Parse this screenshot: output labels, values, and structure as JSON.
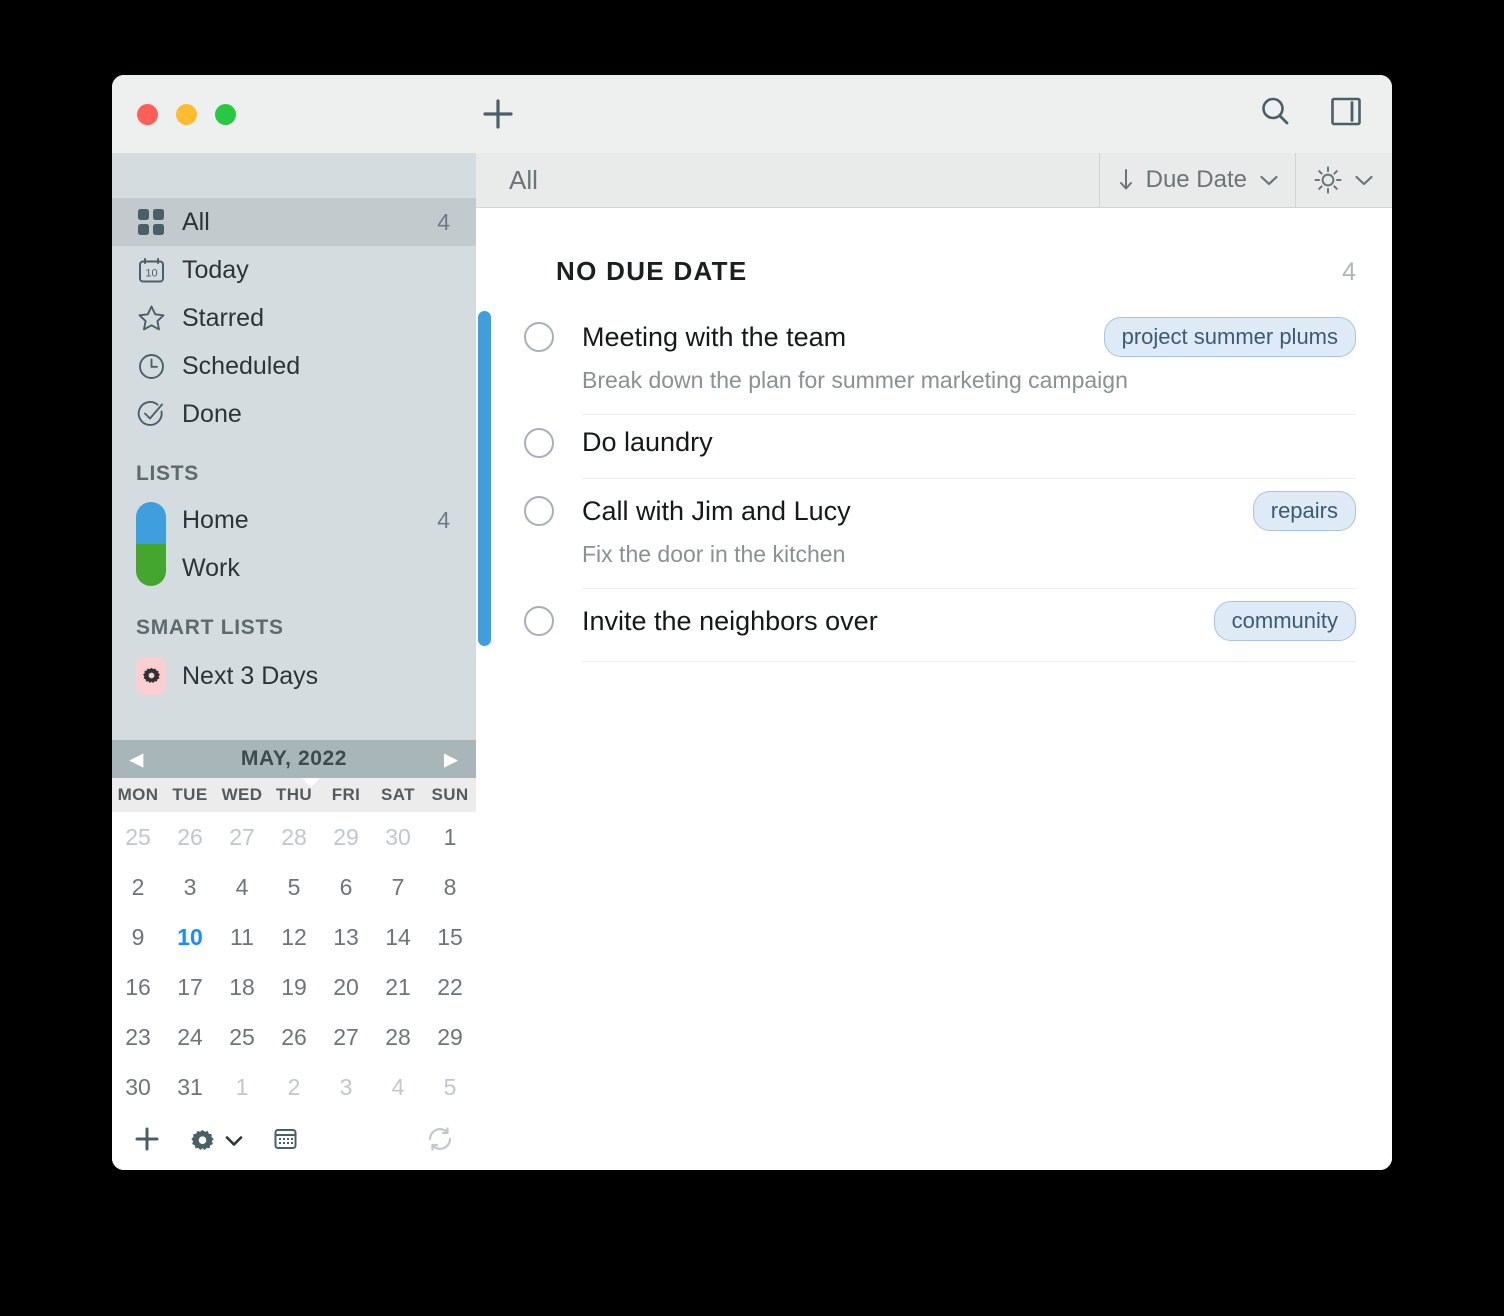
{
  "titlebar": {
    "add_label": "+",
    "search_icon": "search-icon",
    "sidebar_toggle_icon": "sidebar-toggle-icon"
  },
  "sidebar": {
    "nav": [
      {
        "label": "All",
        "count": "4",
        "icon": "grid-icon",
        "selected": true
      },
      {
        "label": "Today",
        "count": "",
        "icon": "calendar-day-icon",
        "selected": false
      },
      {
        "label": "Starred",
        "count": "",
        "icon": "star-icon",
        "selected": false
      },
      {
        "label": "Scheduled",
        "count": "",
        "icon": "clock-icon",
        "selected": false
      },
      {
        "label": "Done",
        "count": "",
        "icon": "check-circle-icon",
        "selected": false
      }
    ],
    "lists_header": "LISTS",
    "lists": [
      {
        "label": "Home",
        "count": "4",
        "color": "#3f9ede"
      },
      {
        "label": "Work",
        "count": "",
        "color": "#45a62f"
      }
    ],
    "smart_header": "SMART LISTS",
    "smart_lists": [
      {
        "label": "Next 3 Days",
        "icon": "gear-icon",
        "badge_color": "#fbcfcf"
      }
    ]
  },
  "calendar": {
    "title": "MAY, 2022",
    "prev_label": "◀",
    "next_label": "▶",
    "day_names": [
      "MON",
      "TUE",
      "WED",
      "THU",
      "FRI",
      "SAT",
      "SUN"
    ],
    "weeks": [
      [
        {
          "d": "25",
          "state": "muted"
        },
        {
          "d": "26",
          "state": "muted"
        },
        {
          "d": "27",
          "state": "muted"
        },
        {
          "d": "28",
          "state": "muted"
        },
        {
          "d": "29",
          "state": "muted"
        },
        {
          "d": "30",
          "state": "muted"
        },
        {
          "d": "1",
          "state": "normal"
        }
      ],
      [
        {
          "d": "2",
          "state": "normal"
        },
        {
          "d": "3",
          "state": "normal"
        },
        {
          "d": "4",
          "state": "normal"
        },
        {
          "d": "5",
          "state": "normal"
        },
        {
          "d": "6",
          "state": "normal"
        },
        {
          "d": "7",
          "state": "normal"
        },
        {
          "d": "8",
          "state": "normal"
        }
      ],
      [
        {
          "d": "9",
          "state": "normal"
        },
        {
          "d": "10",
          "state": "today"
        },
        {
          "d": "11",
          "state": "normal"
        },
        {
          "d": "12",
          "state": "normal"
        },
        {
          "d": "13",
          "state": "normal"
        },
        {
          "d": "14",
          "state": "normal"
        },
        {
          "d": "15",
          "state": "normal"
        }
      ],
      [
        {
          "d": "16",
          "state": "normal"
        },
        {
          "d": "17",
          "state": "normal"
        },
        {
          "d": "18",
          "state": "normal"
        },
        {
          "d": "19",
          "state": "normal"
        },
        {
          "d": "20",
          "state": "normal"
        },
        {
          "d": "21",
          "state": "normal"
        },
        {
          "d": "22",
          "state": "normal"
        }
      ],
      [
        {
          "d": "23",
          "state": "normal"
        },
        {
          "d": "24",
          "state": "normal"
        },
        {
          "d": "25",
          "state": "normal"
        },
        {
          "d": "26",
          "state": "normal"
        },
        {
          "d": "27",
          "state": "normal"
        },
        {
          "d": "28",
          "state": "normal"
        },
        {
          "d": "29",
          "state": "normal"
        }
      ],
      [
        {
          "d": "30",
          "state": "normal"
        },
        {
          "d": "31",
          "state": "normal"
        },
        {
          "d": "1",
          "state": "muted"
        },
        {
          "d": "2",
          "state": "muted"
        },
        {
          "d": "3",
          "state": "muted"
        },
        {
          "d": "4",
          "state": "muted"
        },
        {
          "d": "5",
          "state": "muted"
        }
      ]
    ],
    "footer_icons": [
      "plus-icon",
      "gear-icon",
      "chevron-down-icon",
      "calendar-icon",
      "sync-icon"
    ]
  },
  "main": {
    "title": "All",
    "sort": {
      "direction_icon": "sort-descending-icon",
      "label": "Due Date",
      "chevron": "chevron-down-icon"
    },
    "theme": {
      "icon": "brightness-icon",
      "chevron": "chevron-down-icon"
    },
    "group": {
      "title": "NO DUE DATE",
      "count": "4"
    },
    "tasks": [
      {
        "title": "Meeting with the team",
        "note": "Break down the plan for summer marketing campaign",
        "tag": "project summer plums",
        "done": false
      },
      {
        "title": "Do laundry",
        "note": "",
        "tag": "",
        "done": false
      },
      {
        "title": "Call with Jim and Lucy",
        "note": "Fix the door in the kitchen",
        "tag": "repairs",
        "done": false
      },
      {
        "title": "Invite the neighbors over",
        "note": "",
        "tag": "community",
        "done": false
      }
    ]
  },
  "colors": {
    "accent": "#3f9ede",
    "today": "#1a8cff",
    "tag_bg": "#dfeaf7",
    "tag_border": "#a9c4dd"
  }
}
